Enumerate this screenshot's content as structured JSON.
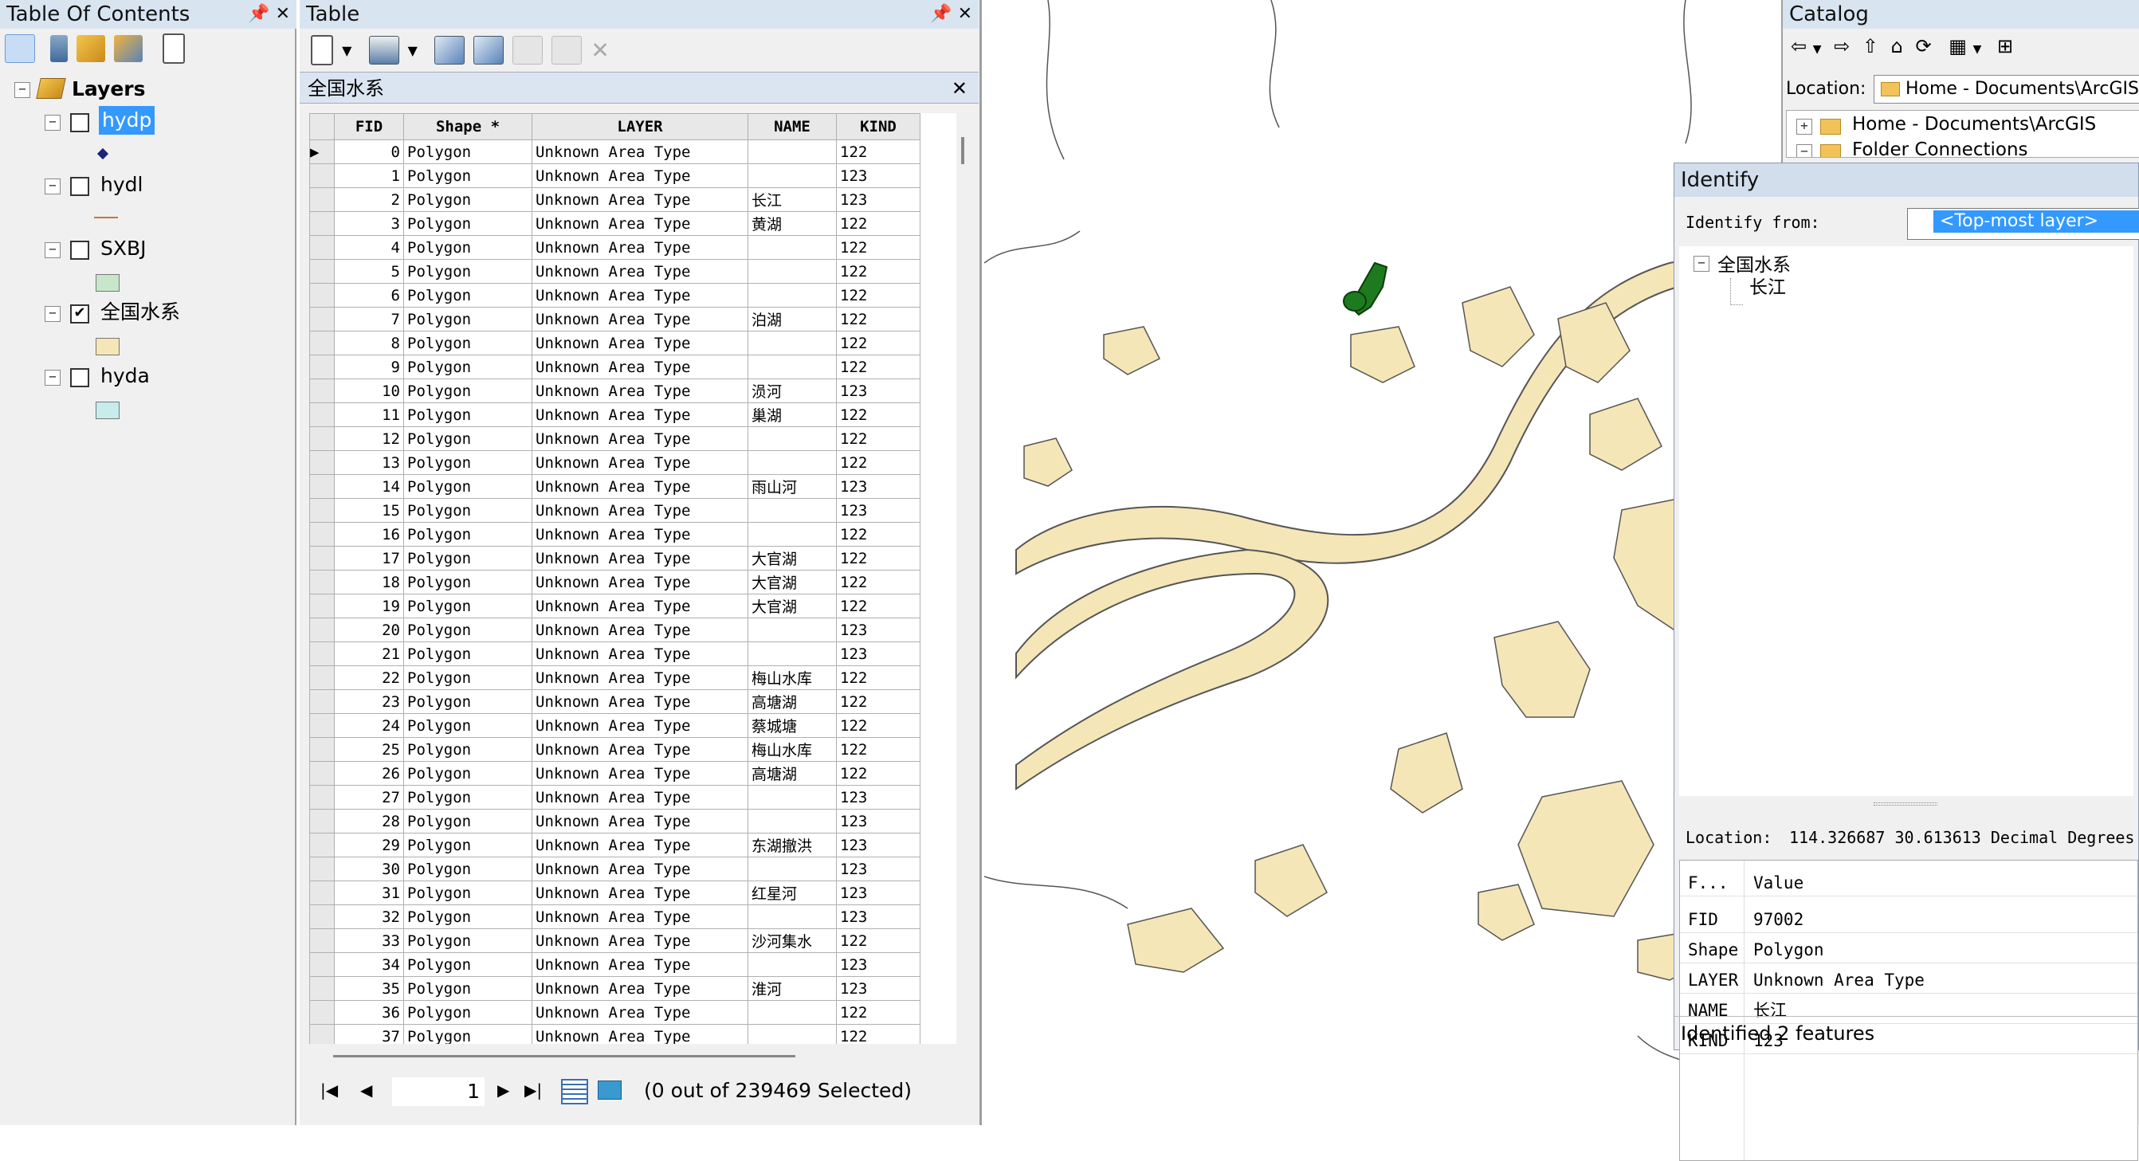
{
  "toc": {
    "title": "Table Of Contents",
    "root": "Layers",
    "layers": [
      {
        "name": "hydp",
        "checked": false,
        "selected": true,
        "symbol": "point"
      },
      {
        "name": "hydl",
        "checked": false,
        "selected": false,
        "symbol": "line"
      },
      {
        "name": "SXBJ",
        "checked": false,
        "selected": false,
        "symbol": "fill-green"
      },
      {
        "name": "全国水系",
        "checked": true,
        "selected": false,
        "symbol": "fill-tan"
      },
      {
        "name": "hyda",
        "checked": false,
        "selected": false,
        "symbol": "fill-cyan"
      }
    ],
    "check_mark": "✔"
  },
  "table": {
    "title": "Table",
    "tab_name": "全国水系",
    "columns": [
      "FID",
      "Shape *",
      "LAYER",
      "NAME",
      "KIND"
    ],
    "rows": [
      {
        "fid": "0",
        "shape": "Polygon",
        "layer": "Unknown Area Type",
        "name": "",
        "kind": "122"
      },
      {
        "fid": "1",
        "shape": "Polygon",
        "layer": "Unknown Area Type",
        "name": "",
        "kind": "123"
      },
      {
        "fid": "2",
        "shape": "Polygon",
        "layer": "Unknown Area Type",
        "name": "长江",
        "kind": "123"
      },
      {
        "fid": "3",
        "shape": "Polygon",
        "layer": "Unknown Area Type",
        "name": "黄湖",
        "kind": "122"
      },
      {
        "fid": "4",
        "shape": "Polygon",
        "layer": "Unknown Area Type",
        "name": "",
        "kind": "122"
      },
      {
        "fid": "5",
        "shape": "Polygon",
        "layer": "Unknown Area Type",
        "name": "",
        "kind": "122"
      },
      {
        "fid": "6",
        "shape": "Polygon",
        "layer": "Unknown Area Type",
        "name": "",
        "kind": "122"
      },
      {
        "fid": "7",
        "shape": "Polygon",
        "layer": "Unknown Area Type",
        "name": "泊湖",
        "kind": "122"
      },
      {
        "fid": "8",
        "shape": "Polygon",
        "layer": "Unknown Area Type",
        "name": "",
        "kind": "122"
      },
      {
        "fid": "9",
        "shape": "Polygon",
        "layer": "Unknown Area Type",
        "name": "",
        "kind": "122"
      },
      {
        "fid": "10",
        "shape": "Polygon",
        "layer": "Unknown Area Type",
        "name": "涢河",
        "kind": "123"
      },
      {
        "fid": "11",
        "shape": "Polygon",
        "layer": "Unknown Area Type",
        "name": "巢湖",
        "kind": "122"
      },
      {
        "fid": "12",
        "shape": "Polygon",
        "layer": "Unknown Area Type",
        "name": "",
        "kind": "122"
      },
      {
        "fid": "13",
        "shape": "Polygon",
        "layer": "Unknown Area Type",
        "name": "",
        "kind": "122"
      },
      {
        "fid": "14",
        "shape": "Polygon",
        "layer": "Unknown Area Type",
        "name": "雨山河",
        "kind": "123"
      },
      {
        "fid": "15",
        "shape": "Polygon",
        "layer": "Unknown Area Type",
        "name": "",
        "kind": "123"
      },
      {
        "fid": "16",
        "shape": "Polygon",
        "layer": "Unknown Area Type",
        "name": "",
        "kind": "122"
      },
      {
        "fid": "17",
        "shape": "Polygon",
        "layer": "Unknown Area Type",
        "name": "大官湖",
        "kind": "122"
      },
      {
        "fid": "18",
        "shape": "Polygon",
        "layer": "Unknown Area Type",
        "name": "大官湖",
        "kind": "122"
      },
      {
        "fid": "19",
        "shape": "Polygon",
        "layer": "Unknown Area Type",
        "name": "大官湖",
        "kind": "122"
      },
      {
        "fid": "20",
        "shape": "Polygon",
        "layer": "Unknown Area Type",
        "name": "",
        "kind": "123"
      },
      {
        "fid": "21",
        "shape": "Polygon",
        "layer": "Unknown Area Type",
        "name": "",
        "kind": "123"
      },
      {
        "fid": "22",
        "shape": "Polygon",
        "layer": "Unknown Area Type",
        "name": "梅山水库",
        "kind": "122"
      },
      {
        "fid": "23",
        "shape": "Polygon",
        "layer": "Unknown Area Type",
        "name": "高塘湖",
        "kind": "122"
      },
      {
        "fid": "24",
        "shape": "Polygon",
        "layer": "Unknown Area Type",
        "name": "蔡城塘",
        "kind": "122"
      },
      {
        "fid": "25",
        "shape": "Polygon",
        "layer": "Unknown Area Type",
        "name": "梅山水库",
        "kind": "122"
      },
      {
        "fid": "26",
        "shape": "Polygon",
        "layer": "Unknown Area Type",
        "name": "高塘湖",
        "kind": "122"
      },
      {
        "fid": "27",
        "shape": "Polygon",
        "layer": "Unknown Area Type",
        "name": "",
        "kind": "123"
      },
      {
        "fid": "28",
        "shape": "Polygon",
        "layer": "Unknown Area Type",
        "name": "",
        "kind": "123"
      },
      {
        "fid": "29",
        "shape": "Polygon",
        "layer": "Unknown Area Type",
        "name": "东湖撤洪",
        "kind": "123"
      },
      {
        "fid": "30",
        "shape": "Polygon",
        "layer": "Unknown Area Type",
        "name": "",
        "kind": "123"
      },
      {
        "fid": "31",
        "shape": "Polygon",
        "layer": "Unknown Area Type",
        "name": "红星河",
        "kind": "123"
      },
      {
        "fid": "32",
        "shape": "Polygon",
        "layer": "Unknown Area Type",
        "name": "",
        "kind": "123"
      },
      {
        "fid": "33",
        "shape": "Polygon",
        "layer": "Unknown Area Type",
        "name": "沙河集水",
        "kind": "122"
      },
      {
        "fid": "34",
        "shape": "Polygon",
        "layer": "Unknown Area Type",
        "name": "",
        "kind": "123"
      },
      {
        "fid": "35",
        "shape": "Polygon",
        "layer": "Unknown Area Type",
        "name": "淮河",
        "kind": "123"
      },
      {
        "fid": "36",
        "shape": "Polygon",
        "layer": "Unknown Area Type",
        "name": "",
        "kind": "122"
      },
      {
        "fid": "37",
        "shape": "Polygon",
        "layer": "Unknown Area Type",
        "name": "",
        "kind": "122"
      }
    ],
    "current_record": "1",
    "selection_status": "(0 out of 239469 Selected)"
  },
  "catalog": {
    "title": "Catalog",
    "location_label": "Location:",
    "location_value": "Home - Documents\\ArcGIS",
    "tree": [
      "Home - Documents\\ArcGIS",
      "Folder Connections"
    ]
  },
  "identify": {
    "title": "Identify",
    "from_label": "Identify from:",
    "from_value": "<Top-most layer>",
    "tree_layer": "全国水系",
    "tree_feature": "长江",
    "location_label": "Location:",
    "location_value": "114.326687   30.613613 Decimal Degrees",
    "field_header": "F...",
    "value_header": "Value",
    "attributes": [
      {
        "field": "FID",
        "value": "97002"
      },
      {
        "field": "Shape",
        "value": "Polygon"
      },
      {
        "field": "LAYER",
        "value": "Unknown Area Type"
      },
      {
        "field": "NAME",
        "value": "长江"
      },
      {
        "field": "KIND",
        "value": "123"
      }
    ],
    "status": "Identified 2 features"
  },
  "colors": {
    "water_fill": "#f5e6b8",
    "water_outline": "#555555",
    "highlight": "#1e7a1e",
    "titlebar": "#d9e4f1",
    "selection": "#3399ff"
  }
}
